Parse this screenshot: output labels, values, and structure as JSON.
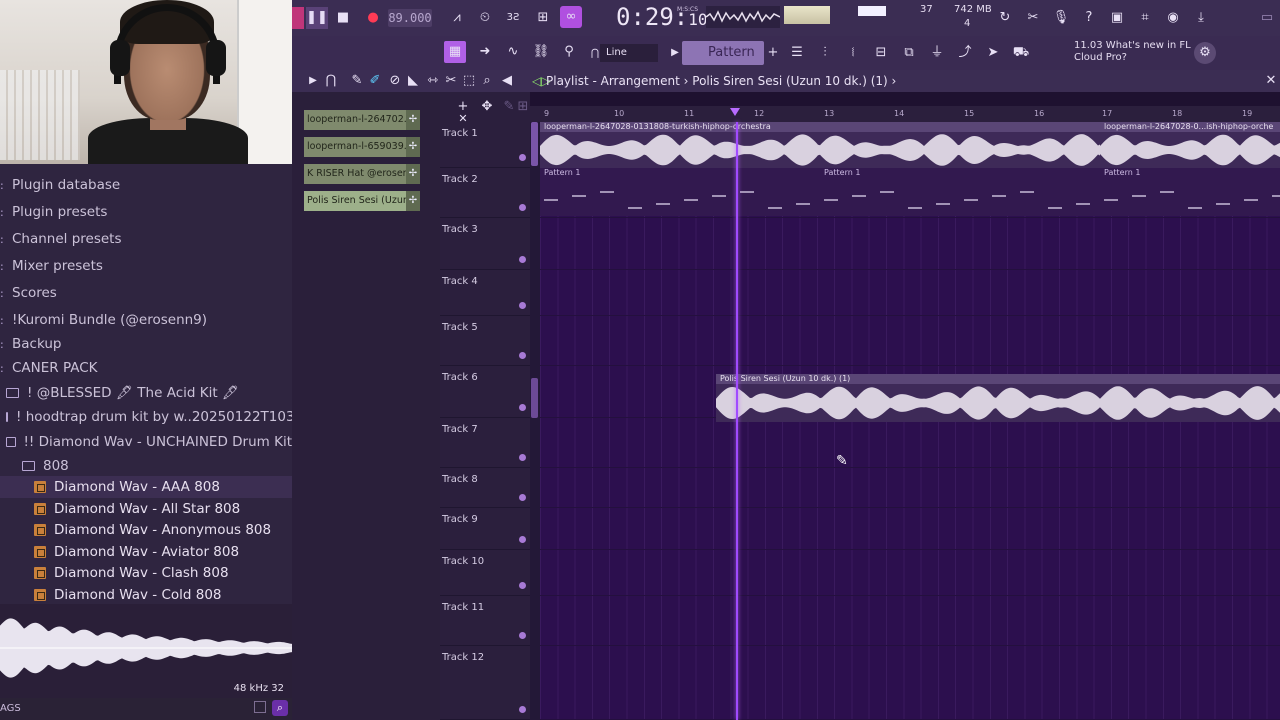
{
  "toolbar": {
    "tempo": "89.000",
    "time_main": "0:29:",
    "time_small": "10",
    "time_unit": "M:S:CS",
    "pattern": "Pattern 1",
    "snap": "Line",
    "cpu_count": "37",
    "ram": "742 MB",
    "poly": "4",
    "news_line1": "11.03  What's new in FL",
    "news_line2": "Cloud Pro?"
  },
  "browser": {
    "items": [
      {
        "label": "Plugin database",
        "kind": "cat"
      },
      {
        "label": "Plugin presets",
        "kind": "cat"
      },
      {
        "label": "Channel presets",
        "kind": "cat"
      },
      {
        "label": "Mixer presets",
        "kind": "cat"
      },
      {
        "label": "Scores",
        "kind": "cat"
      },
      {
        "label": "!Kuromi Bundle (@erosenn9)",
        "kind": "cat"
      },
      {
        "label": "Backup",
        "kind": "cat"
      },
      {
        "label": "CANER PACK",
        "kind": "cat"
      },
      {
        "label": "! @BLESSED 🖋 The Acid Kit 🖋",
        "kind": "folder"
      },
      {
        "label": "! hoodtrap drum kit by w..20250122T103103Z-001",
        "kind": "folder"
      },
      {
        "label": "!! Diamond Wav - UNCHAINED Drum Kit",
        "kind": "folder"
      },
      {
        "label": "808",
        "kind": "subfolder"
      },
      {
        "label": "Diamond Wav - AAA 808",
        "kind": "file"
      },
      {
        "label": "Diamond Wav - All Star 808",
        "kind": "file"
      },
      {
        "label": "Diamond Wav - Anonymous 808",
        "kind": "file"
      },
      {
        "label": "Diamond Wav - Aviator 808",
        "kind": "file"
      },
      {
        "label": "Diamond Wav - Clash 808",
        "kind": "file"
      },
      {
        "label": "Diamond Wav - Cold 808",
        "kind": "file"
      }
    ],
    "wave_info": "48 kHz 32",
    "tags_label": "AGS"
  },
  "playlist": {
    "title": "Playlist - Arrangement",
    "clip_name": "Polis Siren Sesi (Uzun 10 dk.) (1)",
    "picker": [
      "looperman-l-264702...",
      "looperman-l-659039...",
      "K RISER Hat @erosen...",
      "Polis Siren Sesi (Uzun..."
    ],
    "ruler": [
      "9",
      "10",
      "11",
      "12",
      "13",
      "14",
      "15",
      "16",
      "17",
      "18",
      "19"
    ],
    "tracks": [
      "Track 1",
      "Track 2",
      "Track 3",
      "Track 4",
      "Track 5",
      "Track 6",
      "Track 7",
      "Track 8",
      "Track 9",
      "Track 10",
      "Track 11",
      "Track 12"
    ],
    "clips": {
      "t1a": "looperman-l-2647028-0131808-turkish-hiphop-orchestra",
      "t1b": "looperman-l-2647028-0...ish-hiphop-orche",
      "p1": "Pattern 1",
      "p2": "Pattern 1",
      "p3": "Pattern 1",
      "siren": "Polis Siren Sesi (Uzun 10 dk.) (1)"
    }
  },
  "colors": {
    "accent": "#a14bff",
    "audio_clip": "#5a4676",
    "picker_clip": "#7f8a6d"
  }
}
